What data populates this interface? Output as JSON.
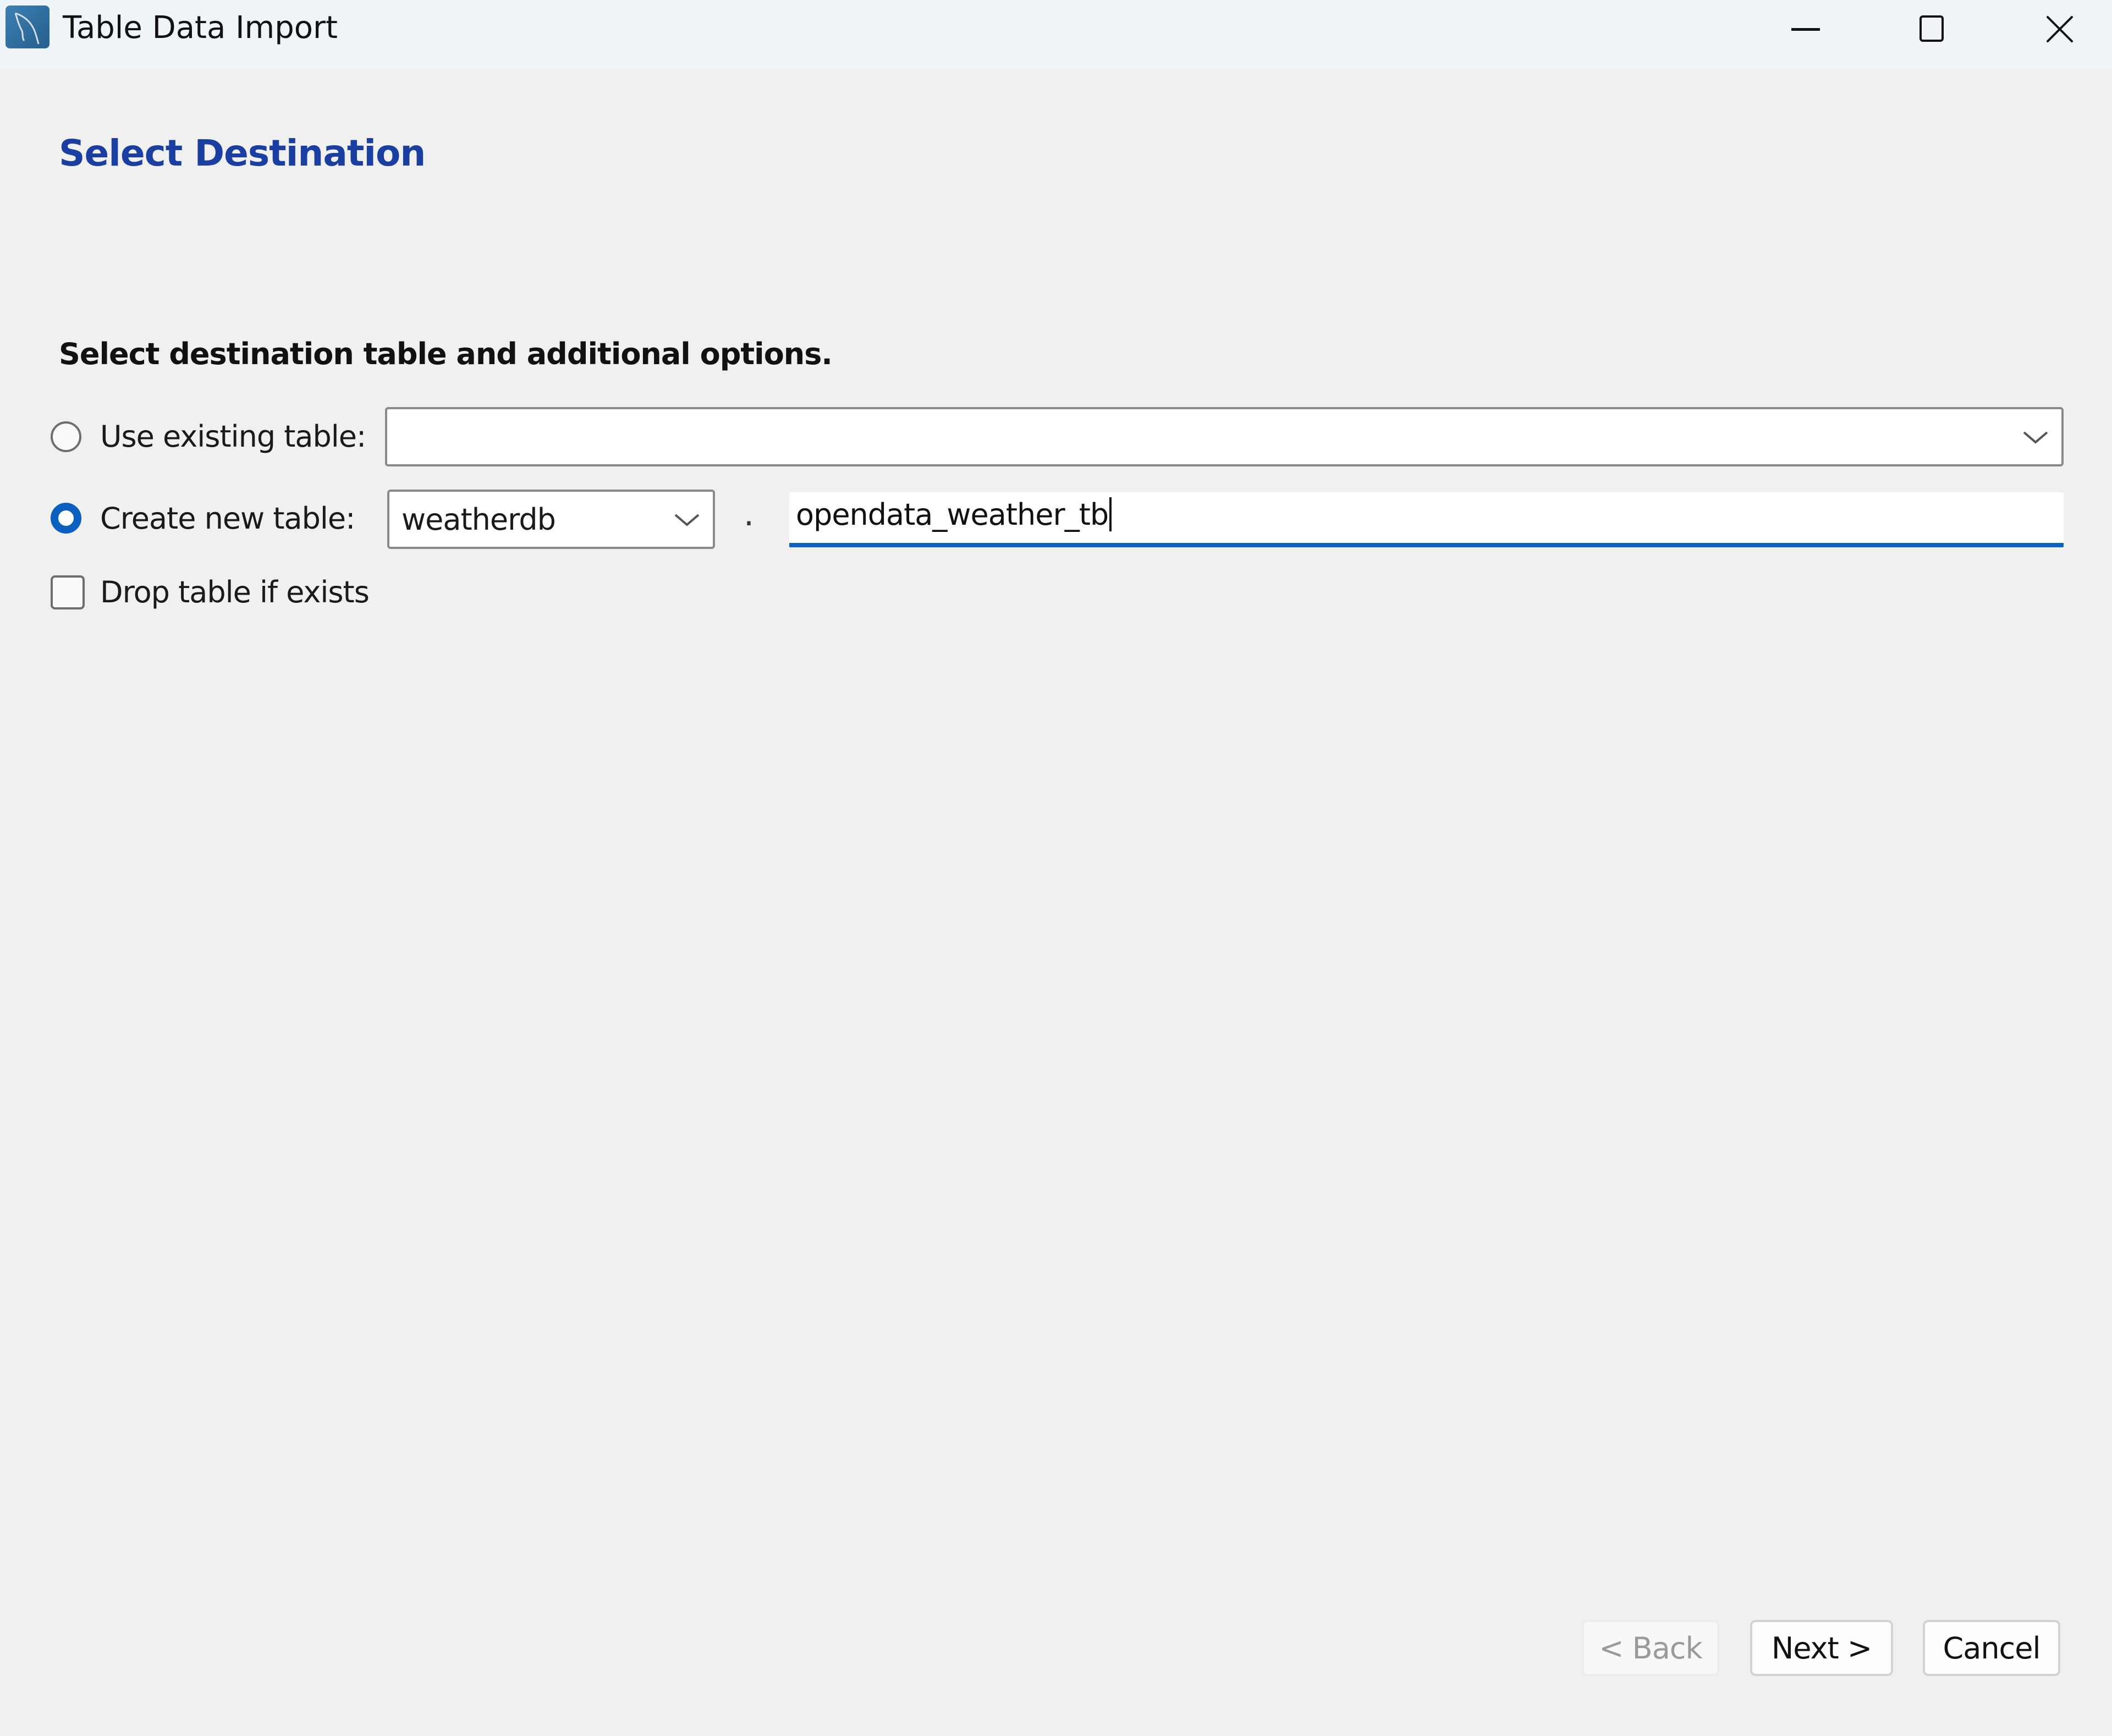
{
  "window": {
    "title": "Table Data Import",
    "app_icon": "mysql-workbench-dolphin-icon",
    "controls": [
      "minimize-icon",
      "maximize-icon",
      "close-icon"
    ]
  },
  "page": {
    "heading": "Select Destination",
    "subheading": "Select destination table and additional options."
  },
  "options": {
    "use_existing": {
      "label": "Use existing table:",
      "selected": false,
      "combo_value": ""
    },
    "create_new": {
      "label": "Create new table:",
      "selected": true,
      "schema_value": "weatherdb",
      "separator": ".",
      "table_name_value": "opendata_weather_tb"
    },
    "drop_if_exists": {
      "label": "Drop table if exists",
      "checked": false
    }
  },
  "footer": {
    "back_label": "< Back",
    "back_enabled": false,
    "next_label": "Next >",
    "cancel_label": "Cancel"
  },
  "colors": {
    "accent": "#0a5fbf",
    "heading": "#1b3fa0",
    "titlebar_bg": "#eff4f9",
    "body_bg": "#f0f0f0"
  }
}
